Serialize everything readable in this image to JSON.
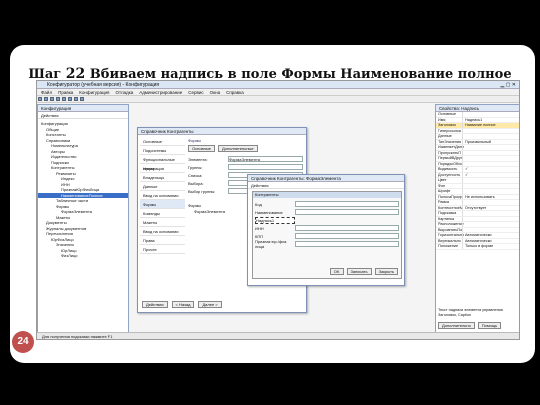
{
  "slide": {
    "title_prefix": "Шаг",
    "title_number": "22",
    "title_rest": "Вбиваем надпись в поле Формы Наименование полное",
    "slide_number": "24"
  },
  "app": {
    "window_title": "Конфигуратор (учебная версия) - Конфигурация",
    "menu": [
      "Файл",
      "Правка",
      "Конфигурация",
      "Отладка",
      "Администрирование",
      "Сервис",
      "Окна",
      "Справка"
    ],
    "config_panel": {
      "title": "Конфигурация",
      "actions": "Действия",
      "tree": [
        "Конфигурация",
        "Общие",
        "Константы",
        "Справочники",
        "Номенклатура",
        "Авторы",
        "Издательство",
        "Подписки",
        "Контрагенты",
        "Реквизиты",
        "Индекс",
        "ИНН",
        "ПризнакЮрФизЛица",
        "НаименованиеПолное",
        "Табличные части",
        "Формы",
        "ФормаЭлемента",
        "Макеты",
        "Документы",
        "Журналы документов",
        "Перечисления",
        "ЮрФизЛицо",
        "Значения",
        "ЮрЛицо",
        "ФизЛицо"
      ]
    },
    "object_window": {
      "title": "Справочник Контрагенты",
      "tabs": [
        "Основные",
        "Подсистемы",
        "Функциональные опции",
        "Нумерация",
        "Владельцы",
        "Данные",
        "Ввод на основании",
        "Формы",
        "Команды",
        "Макеты",
        "Ввод на основании",
        "Права",
        "Прочее"
      ],
      "forms_label": "Формы",
      "main_label": "Основные",
      "extra_label": "Дополнительные",
      "element_label": "Элемента:",
      "element_value": "ФормаЭлемента",
      "group_label": "Группы:",
      "list_label": "Списка:",
      "choice_label": "Выбора:",
      "group_choice_label": "Выбор группы:",
      "forms_tree": [
        "Формы",
        "ФормаЭлемента"
      ],
      "actions": "Действия",
      "back": "< Назад",
      "next": "Далее >"
    },
    "form_window": {
      "title": "Справочник Контрагенты: ФормаЭлемента",
      "actions": "Действия",
      "inner_title": "Контрагенты",
      "fields": [
        "Код",
        "Наименование",
        "Надпись1",
        "ИНН",
        "КПП",
        "Признак юр./физ. лица"
      ],
      "ok": "OK",
      "write": "Записать",
      "close": "Закрыть"
    },
    "properties": {
      "title": "Свойства: Надпись",
      "rows": [
        [
          "Основные",
          ""
        ],
        [
          "Имя",
          "Надпись1"
        ],
        [
          "Заголовок",
          "Название полное"
        ],
        [
          "Гиперссылка",
          ""
        ],
        [
          "Данные",
          ""
        ],
        [
          "ТипЗначения",
          "Произвольный"
        ],
        [
          "ИзменяетДанн",
          ""
        ],
        [
          "ПропускатьП",
          ""
        ],
        [
          "ПервыйВДруг",
          ""
        ],
        [
          "ПорядокОбхо",
          ""
        ],
        [
          "Видимость",
          "✓"
        ],
        [
          "Доступность",
          "✓"
        ],
        [
          "Цвет",
          ""
        ],
        [
          "Фон",
          ""
        ],
        [
          "Шрифт",
          ""
        ],
        [
          "ПолосаПрокр",
          "Не использовать"
        ],
        [
          "Рамка",
          ""
        ],
        [
          "КонтекстноеМ",
          "Отсутствует"
        ],
        [
          "Подсказка",
          ""
        ],
        [
          "Картинка",
          ""
        ],
        [
          "Расположение",
          ""
        ],
        [
          "ВыровнятьПо",
          ""
        ],
        [
          "Горизонтально",
          "Автоматически"
        ],
        [
          "Вертикально",
          "Автоматически"
        ],
        [
          "Положение",
          "Только в форме"
        ]
      ],
      "help_text": "Текст надписи элемента управления Заголовок, Caption",
      "more_button": "Дополнительно",
      "help_button": "Помощь"
    },
    "status": "Для получения подсказки нажмите F1"
  }
}
